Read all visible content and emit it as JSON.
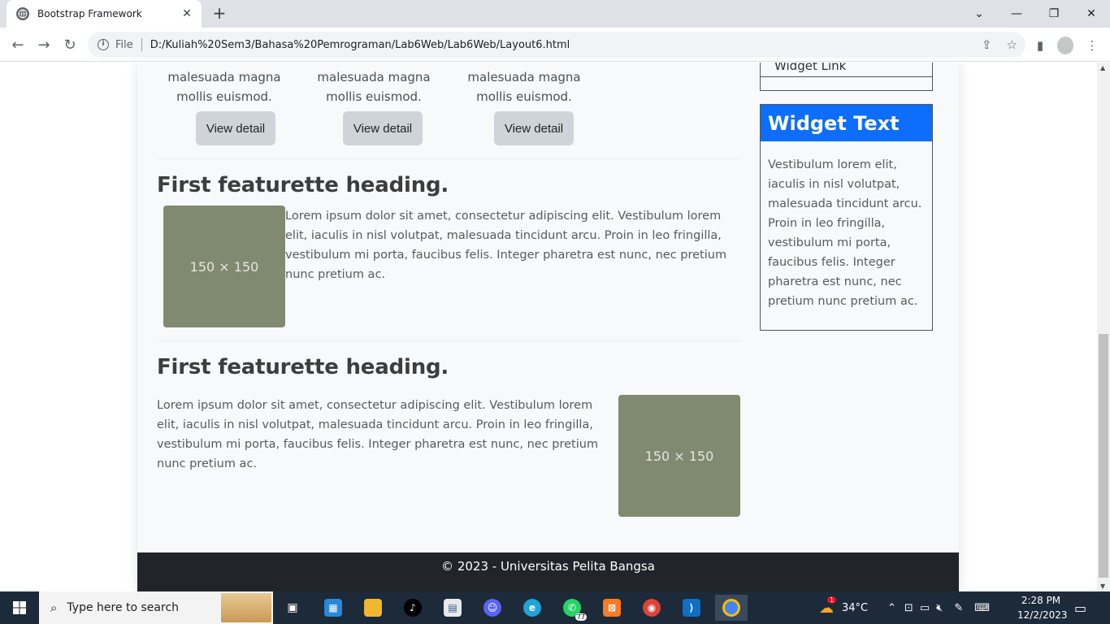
{
  "browser": {
    "tab_title": "Bootstrap Framework",
    "tab_close": "✕",
    "new_tab": "+",
    "file_label": "File",
    "url": "D:/Kuliah%20Sem3/Bahasa%20Pemrograman/Lab6Web/Lab6Web/Layout6.html"
  },
  "cards": [
    {
      "text_line1": "malesuada magna",
      "text_line2": "mollis euismod.",
      "button": "View detail"
    },
    {
      "text_line1": "malesuada magna",
      "text_line2": "mollis euismod.",
      "button": "View detail"
    },
    {
      "text_line1": "malesuada magna",
      "text_line2": "mollis euismod.",
      "button": "View detail"
    }
  ],
  "featurettes": [
    {
      "heading": "First featurette heading.",
      "image_label": "150 × 150",
      "text": "Lorem ipsum dolor sit amet, consectetur adipiscing elit. Vestibulum lorem elit, iaculis in nisl volutpat, malesuada tincidunt arcu. Proin in leo fringilla, vestibulum mi porta, faucibus felis. Integer pharetra est nunc, nec pretium nunc pretium ac."
    },
    {
      "heading": "First featurette heading.",
      "image_label": "150 × 150",
      "text": "Lorem ipsum dolor sit amet, consectetur adipiscing elit. Vestibulum lorem elit, iaculis in nisl volutpat, malesuada tincidunt arcu. Proin in leo fringilla, vestibulum mi porta, faucibus felis. Integer pharetra est nunc, nec pretium nunc pretium ac."
    }
  ],
  "sidebar": {
    "widget_link_item": "Widget Link",
    "widget_text_title": "Widget Text",
    "widget_text_body": "Vestibulum lorem elit, iaculis in nisl volutpat, malesuada tincidunt arcu. Proin in leo fringilla, vestibulum mi porta, faucibus felis. Integer pharetra est nunc, nec pretium nunc pretium ac."
  },
  "footer": {
    "text": "© 2023 - Universitas Pelita Bangsa"
  },
  "taskbar": {
    "search_placeholder": "Type here to search",
    "weather_temp": "34°C",
    "weather_badge": "1",
    "whatsapp_badge": "77",
    "time": "2:28 PM",
    "date": "12/2/2023"
  },
  "colors": {
    "accent": "#0d6efd",
    "footer_bg": "#212529",
    "placeholder_bg": "#7f8a71"
  }
}
